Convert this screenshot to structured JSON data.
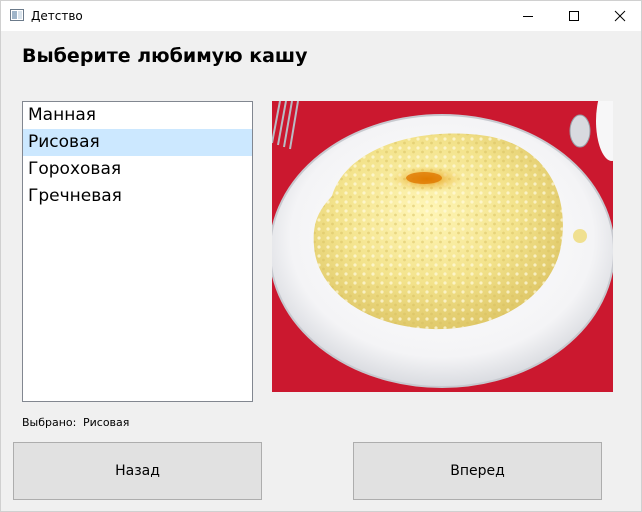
{
  "window": {
    "title": "Детство",
    "icon": "app-window-icon",
    "controls": [
      "minimize-icon",
      "maximize-icon",
      "close-icon"
    ]
  },
  "heading": "Выберите любимую кашу",
  "list": {
    "items": [
      {
        "label": "Манная",
        "selected": false
      },
      {
        "label": "Рисовая",
        "selected": true
      },
      {
        "label": "Гороховая",
        "selected": false
      },
      {
        "label": "Гречневая",
        "selected": false
      }
    ],
    "selection_color": "#cce8ff"
  },
  "image": {
    "subject": "porridge-photo"
  },
  "status": {
    "label": "Выбрано:",
    "value": "Рисовая"
  },
  "buttons": {
    "back": "Назад",
    "next": "Вперед"
  }
}
